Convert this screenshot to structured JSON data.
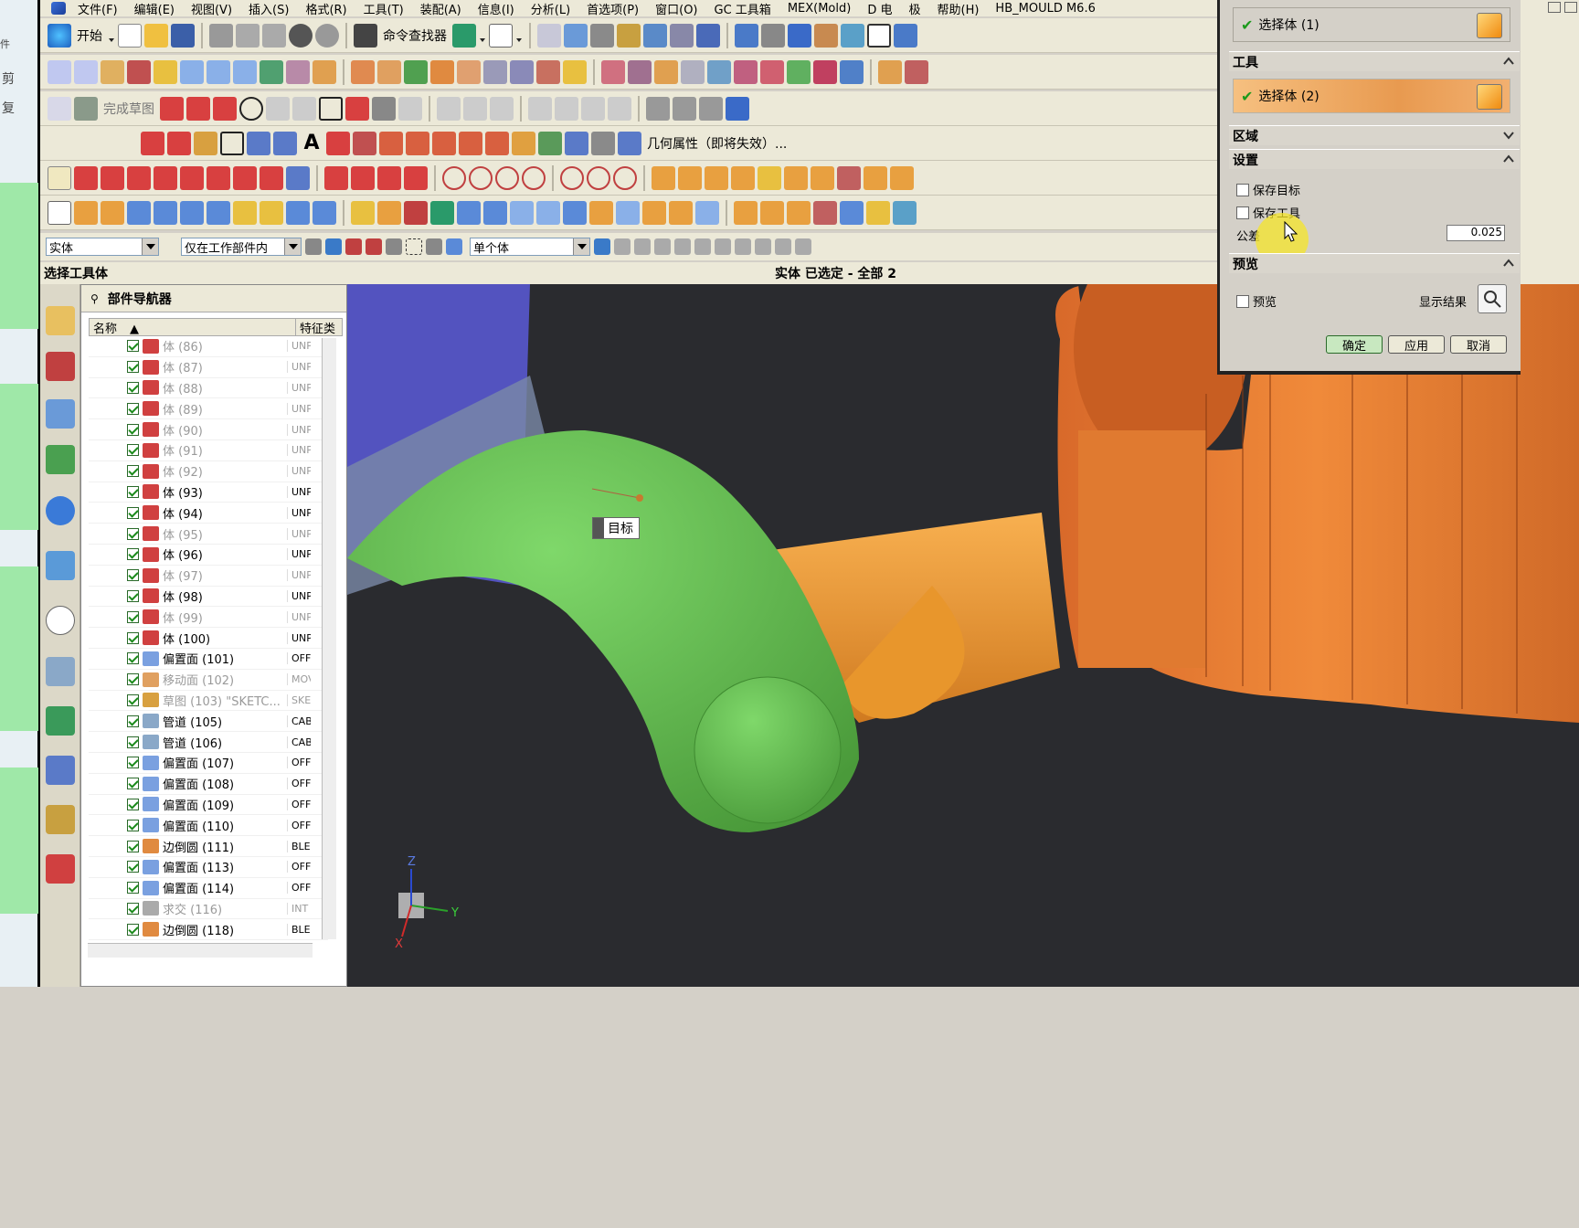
{
  "menubar": [
    "文件(F)",
    "编辑(E)",
    "视图(V)",
    "插入(S)",
    "格式(R)",
    "工具(T)",
    "装配(A)",
    "信息(I)",
    "分析(L)",
    "首选项(P)",
    "窗口(O)",
    "GC 工具箱",
    "MEX(Mold)",
    "D 电",
    "极",
    "帮助(H)",
    "HB_MOULD M6.6"
  ],
  "toolbar": {
    "start_label": "开始",
    "cmd_finder_label": "命令查找器",
    "sketch_label": "完成草图",
    "geom_props_label": "几何属性（即将失效）..."
  },
  "selection": {
    "type_filter": "实体",
    "scope": "仅在工作部件内",
    "body_mode": "单个体"
  },
  "status": {
    "left": "选择工具体",
    "right": "实体 已选定 - 全部 2"
  },
  "part_navigator": {
    "title": "部件导航器",
    "col_name": "名称",
    "col_type": "特征类",
    "rows": [
      {
        "label": "体 (86)",
        "type": "UNP.",
        "dim": true
      },
      {
        "label": "体 (87)",
        "type": "UNP.",
        "dim": true
      },
      {
        "label": "体 (88)",
        "type": "UNP.",
        "dim": true
      },
      {
        "label": "体 (89)",
        "type": "UNP.",
        "dim": true
      },
      {
        "label": "体 (90)",
        "type": "UNP.",
        "dim": true
      },
      {
        "label": "体 (91)",
        "type": "UNP.",
        "dim": true
      },
      {
        "label": "体 (92)",
        "type": "UNP.",
        "dim": true
      },
      {
        "label": "体 (93)",
        "type": "UNP.",
        "dim": false
      },
      {
        "label": "体 (94)",
        "type": "UNP.",
        "dim": false
      },
      {
        "label": "体 (95)",
        "type": "UNP.",
        "dim": true
      },
      {
        "label": "体 (96)",
        "type": "UNP.",
        "dim": false
      },
      {
        "label": "体 (97)",
        "type": "UNP.",
        "dim": true
      },
      {
        "label": "体 (98)",
        "type": "UNP.",
        "dim": false
      },
      {
        "label": "体 (99)",
        "type": "UNP.",
        "dim": true
      },
      {
        "label": "体 (100)",
        "type": "UNP.",
        "dim": false
      },
      {
        "label": "偏置面 (101)",
        "type": "OFF:",
        "dim": false
      },
      {
        "label": "移动面 (102)",
        "type": "MOV.",
        "dim": true
      },
      {
        "label": "草图 (103) \"SKETC...",
        "type": "SKE",
        "dim": true
      },
      {
        "label": "管道 (105)",
        "type": "CAB",
        "dim": false
      },
      {
        "label": "管道 (106)",
        "type": "CAB",
        "dim": false
      },
      {
        "label": "偏置面 (107)",
        "type": "OFF:",
        "dim": false
      },
      {
        "label": "偏置面 (108)",
        "type": "OFF:",
        "dim": false
      },
      {
        "label": "偏置面 (109)",
        "type": "OFF:",
        "dim": false
      },
      {
        "label": "偏置面 (110)",
        "type": "OFF:",
        "dim": false
      },
      {
        "label": "边倒圆 (111)",
        "type": "BLE",
        "dim": false
      },
      {
        "label": "偏置面 (113)",
        "type": "OFF:",
        "dim": false
      },
      {
        "label": "偏置面 (114)",
        "type": "OFF:",
        "dim": false
      },
      {
        "label": "求交 (116)",
        "type": "INT",
        "dim": true
      },
      {
        "label": "边倒圆 (118)",
        "type": "BLE",
        "dim": false
      }
    ]
  },
  "dialog": {
    "target_select": "选择体 (1)",
    "tool_section": "工具",
    "tool_select": "选择体 (2)",
    "region_section": "区域",
    "settings_section": "设置",
    "keep_target": "保存目标",
    "keep_tool": "保存工具",
    "tolerance_label": "公差",
    "tolerance_value": "0.025",
    "preview_section": "预览",
    "preview_label": "预览",
    "show_result": "显示结果",
    "ok": "确定",
    "apply": "应用",
    "cancel": "取消"
  },
  "viewport": {
    "target_tag": "目标",
    "axes": {
      "x": "X",
      "y": "Y",
      "z": "Z"
    }
  },
  "left_strip_text": [
    "件",
    "剪",
    "复"
  ]
}
